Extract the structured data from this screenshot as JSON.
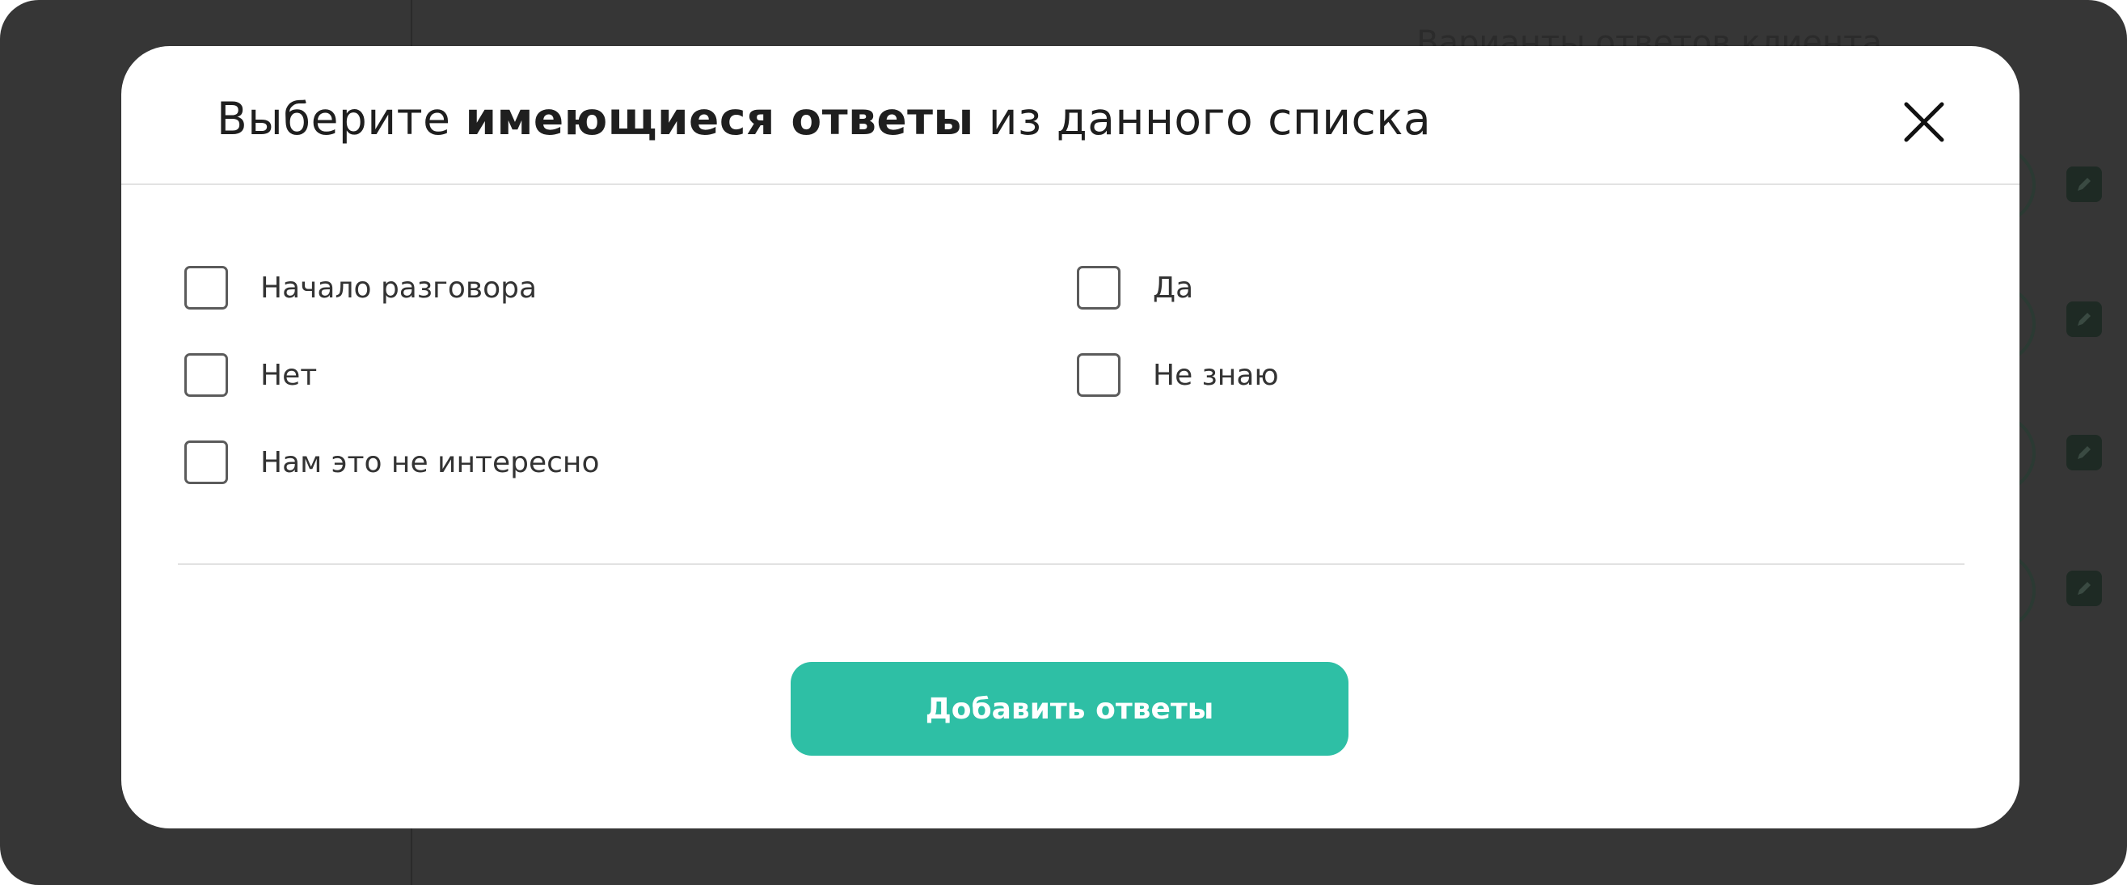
{
  "background": {
    "heading": "Варианты ответов клиента",
    "row_count": 4
  },
  "modal": {
    "title_prefix": "Выберите ",
    "title_bold": "имеющиеся ответы",
    "title_suffix": " из данного списка",
    "close_icon": "close-icon",
    "options": [
      {
        "label": "Начало разговора",
        "checked": false
      },
      {
        "label": "Да",
        "checked": false
      },
      {
        "label": "Нет",
        "checked": false
      },
      {
        "label": "Не знаю",
        "checked": false
      },
      {
        "label": "Нам это не интересно",
        "checked": false
      }
    ],
    "submit_label": "Добавить ответы"
  },
  "colors": {
    "overlay": "#363636",
    "accent": "#2ebfa5",
    "modal_bg": "#ffffff"
  }
}
